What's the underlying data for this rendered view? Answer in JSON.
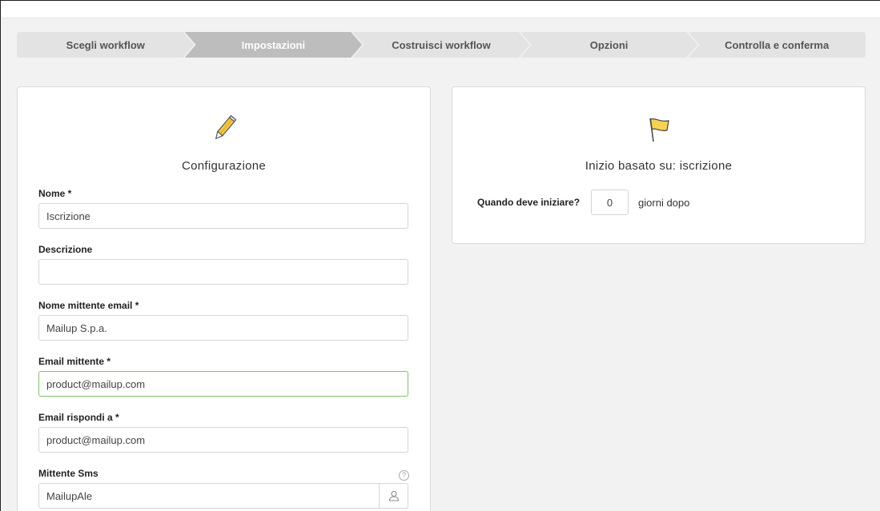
{
  "stepper": {
    "steps": [
      {
        "label": "Scegli workflow",
        "active": false
      },
      {
        "label": "Impostazioni",
        "active": true
      },
      {
        "label": "Costruisci workflow",
        "active": false
      },
      {
        "label": "Opzioni",
        "active": false
      },
      {
        "label": "Controlla e conferma",
        "active": false
      }
    ]
  },
  "configuration": {
    "icon": "pencil-icon",
    "title": "Configurazione",
    "fields": {
      "name": {
        "label": "Nome *",
        "value": "Iscrizione"
      },
      "description": {
        "label": "Descrizione",
        "value": ""
      },
      "sender_name": {
        "label": "Nome mittente email *",
        "value": "Mailup S.p.a."
      },
      "sender_email": {
        "label": "Email mittente *",
        "value": "product@mailup.com"
      },
      "reply_to": {
        "label": "Email rispondi a *",
        "value": "product@mailup.com"
      },
      "sms_sender": {
        "label": "Mittente Sms",
        "value": "MailupAle",
        "help_icon": "question-circle-icon",
        "addon_icon": "user-icon"
      }
    }
  },
  "start": {
    "icon": "flag-icon",
    "title": "Inizio basato su: iscrizione",
    "question": "Quando deve iniziare?",
    "days_value": "0",
    "days_suffix": "giorni dopo"
  },
  "colors": {
    "step_bg": "#e3e3e3",
    "step_active_bg": "#bdbdbd",
    "focus_border": "#7cc46b",
    "pencil_yellow": "#f5c842",
    "flag_yellow": "#f7d154"
  }
}
